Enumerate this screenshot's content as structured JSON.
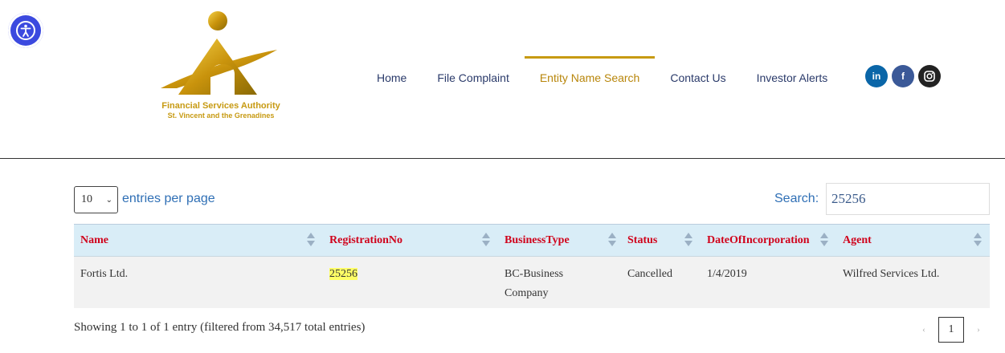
{
  "header": {
    "logo": {
      "line1": "Financial Services Authority",
      "line2": "St. Vincent and the Grenadines"
    },
    "nav": [
      {
        "label": "Home",
        "active": false
      },
      {
        "label": "File Complaint",
        "active": false
      },
      {
        "label": "Entity Name Search",
        "active": true
      },
      {
        "label": "Contact Us",
        "active": false
      },
      {
        "label": "Investor Alerts",
        "active": false
      }
    ],
    "social": [
      {
        "icon": "linkedin-icon",
        "glyph": "in"
      },
      {
        "icon": "facebook-icon",
        "glyph": "f"
      },
      {
        "icon": "instagram-icon",
        "glyph": ""
      }
    ]
  },
  "controls": {
    "per_page_value": "10",
    "per_page_label": "entries per page",
    "search_label": "Search:",
    "search_value": "25256"
  },
  "table": {
    "columns": [
      "Name",
      "RegistrationNo",
      "BusinessType",
      "Status",
      "DateOfIncorporation",
      "Agent"
    ],
    "rows": [
      {
        "name": "Fortis Ltd.",
        "registration_no": "25256",
        "business_type_line1": "BC-Business",
        "business_type_line2": "Company",
        "status": "Cancelled",
        "date": "1/4/2019",
        "agent": "Wilfred Services Ltd."
      }
    ]
  },
  "footer": {
    "info": "Showing 1 to 1 of 1 entry (filtered from 34,517 total entries)",
    "prev": "‹",
    "page": "1",
    "next": "›"
  },
  "colors": {
    "accent_gold": "#c79a12",
    "link_blue": "#2f6fb5",
    "header_red": "#d0021b",
    "thead_bg": "#d9edf7",
    "a11y_blue": "#3b49df"
  }
}
